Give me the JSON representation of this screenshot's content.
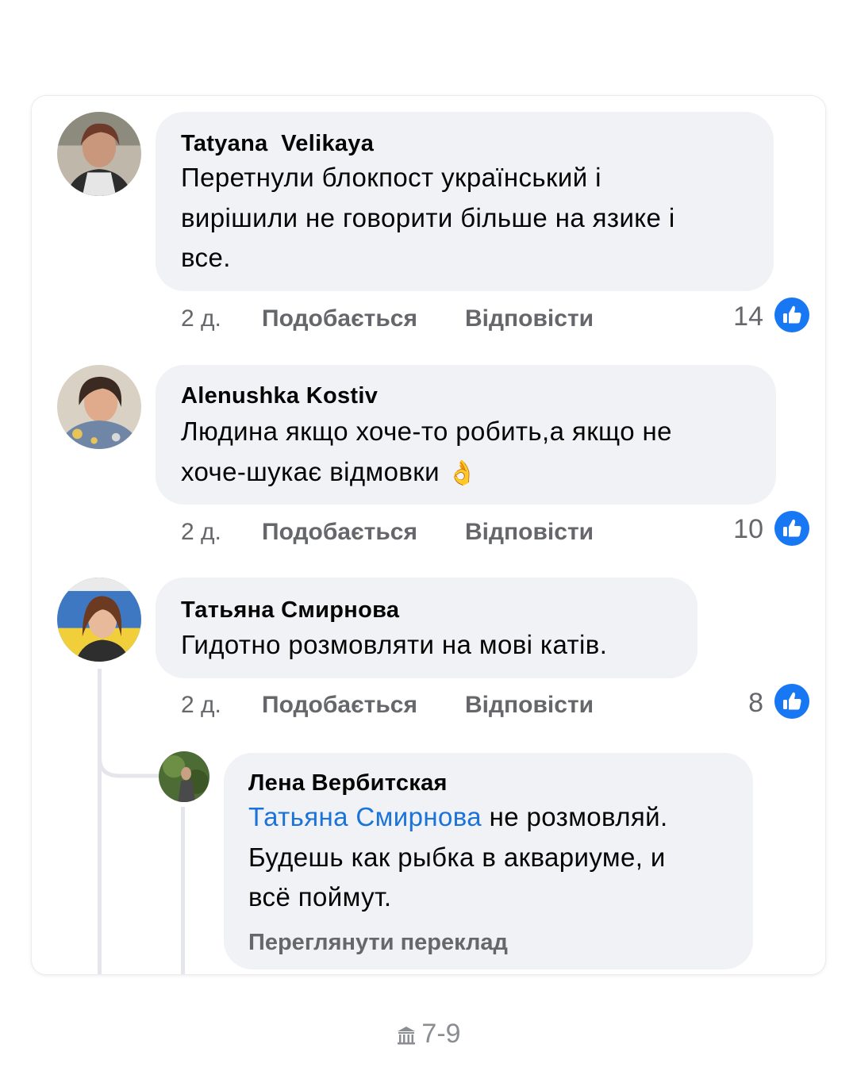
{
  "comments": [
    {
      "author": "Tatyana  Velikaya",
      "lines": [
        "Перетнули блокпост український і",
        "вирішили не говорити більше на язике і",
        "все."
      ],
      "time": "2 д.",
      "like_label": "Подобається",
      "reply_label": "Відповісти",
      "likes": "14"
    },
    {
      "author": "Alenushka Kostiv",
      "lines": [
        "Людина якщо хоче-то робить,а якщо не",
        "хоче-шукає відмовки"
      ],
      "emoji": "👌",
      "time": "2 д.",
      "like_label": "Подобається",
      "reply_label": "Відповісти",
      "likes": "10"
    },
    {
      "author": "Татьяна Смирнова",
      "lines": [
        "Гидотно розмовляти на мові катів."
      ],
      "time": "2 д.",
      "like_label": "Подобається",
      "reply_label": "Відповісти",
      "likes": "8"
    }
  ],
  "reply": {
    "author": "Лена Вербитская",
    "mention": "Татьяна Смирнова",
    "line1_rest": " не розмовляй.",
    "line2": "Будешь как рыбка в аквариуме, и",
    "line3": "всё поймут.",
    "translate_label": "Переглянути переклад"
  },
  "footer": {
    "text": "7-9",
    "icon": "museum-icon"
  },
  "colors": {
    "bubble": "#f0f2f5",
    "like_badge": "#1877f2",
    "mention": "#1a73d9",
    "meta_text": "#65676b"
  }
}
